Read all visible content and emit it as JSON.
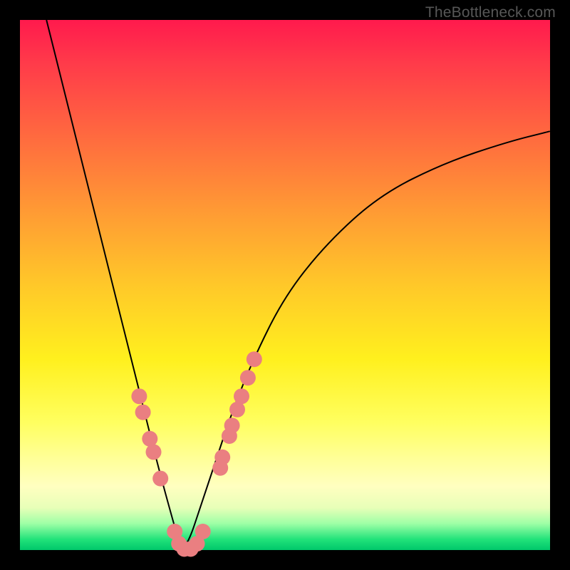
{
  "watermark": "TheBottleneck.com",
  "chart_data": {
    "type": "line",
    "title": "",
    "xlabel": "",
    "ylabel": "",
    "xlim": [
      0,
      1
    ],
    "ylim": [
      0,
      1
    ],
    "grid": false,
    "legend": false,
    "curve": {
      "name": "bottleneck-curve",
      "x": [
        0.05,
        0.08,
        0.11,
        0.14,
        0.17,
        0.2,
        0.23,
        0.26,
        0.29,
        0.305,
        0.32,
        0.34,
        0.37,
        0.4,
        0.44,
        0.5,
        0.58,
        0.68,
        0.8,
        0.92,
        1.0
      ],
      "y": [
        1.0,
        0.88,
        0.76,
        0.64,
        0.52,
        0.4,
        0.28,
        0.16,
        0.05,
        0.0,
        0.02,
        0.08,
        0.17,
        0.26,
        0.36,
        0.48,
        0.58,
        0.67,
        0.73,
        0.77,
        0.79
      ]
    },
    "marker_clusters": [
      {
        "name": "left-cluster",
        "points": [
          {
            "x": 0.225,
            "y": 0.29
          },
          {
            "x": 0.232,
            "y": 0.26
          },
          {
            "x": 0.245,
            "y": 0.21
          },
          {
            "x": 0.252,
            "y": 0.185
          },
          {
            "x": 0.265,
            "y": 0.135
          }
        ]
      },
      {
        "name": "bottom-cluster",
        "points": [
          {
            "x": 0.292,
            "y": 0.035
          },
          {
            "x": 0.3,
            "y": 0.012
          },
          {
            "x": 0.31,
            "y": 0.002
          },
          {
            "x": 0.322,
            "y": 0.002
          },
          {
            "x": 0.334,
            "y": 0.012
          },
          {
            "x": 0.345,
            "y": 0.035
          }
        ]
      },
      {
        "name": "right-cluster",
        "points": [
          {
            "x": 0.378,
            "y": 0.155
          },
          {
            "x": 0.382,
            "y": 0.175
          },
          {
            "x": 0.395,
            "y": 0.215
          },
          {
            "x": 0.4,
            "y": 0.235
          },
          {
            "x": 0.41,
            "y": 0.265
          },
          {
            "x": 0.418,
            "y": 0.29
          },
          {
            "x": 0.43,
            "y": 0.325
          },
          {
            "x": 0.442,
            "y": 0.36
          }
        ]
      }
    ],
    "styles": {
      "line_color": "#000000",
      "line_width": 2,
      "marker_color": "#ea7f81",
      "marker_radius": 11
    }
  }
}
